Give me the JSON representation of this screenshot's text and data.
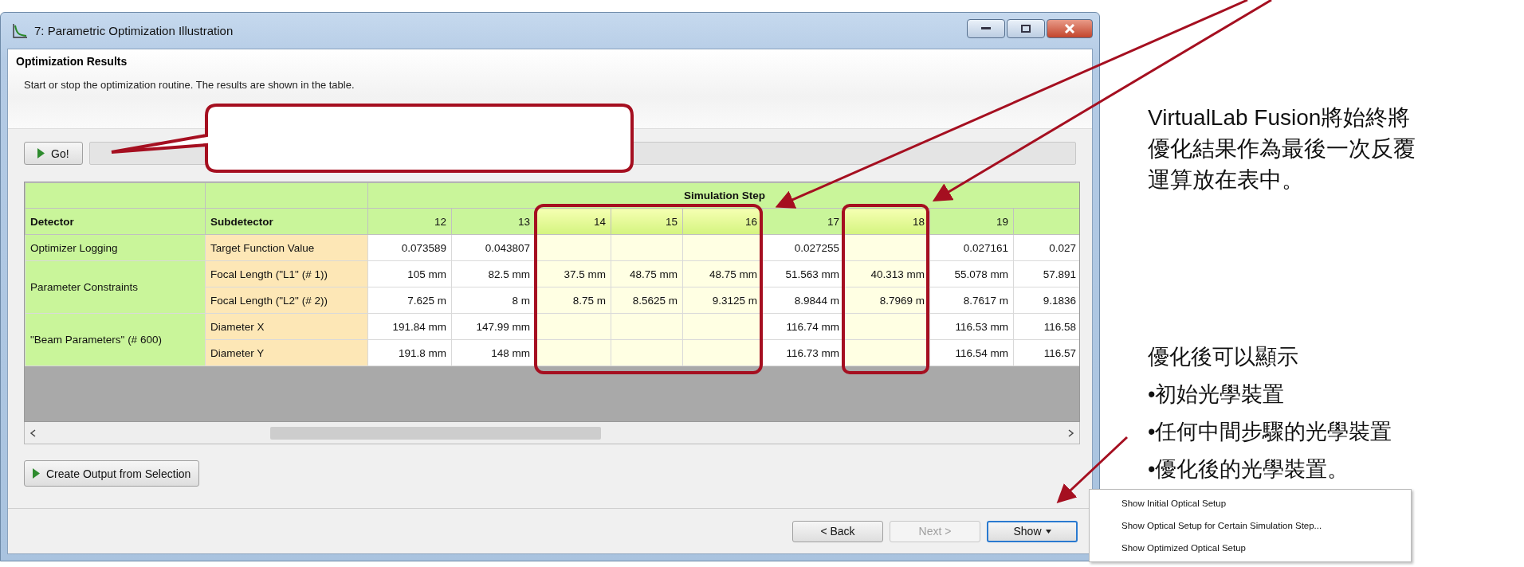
{
  "window": {
    "title": "7: Parametric Optimization Illustration"
  },
  "header": {
    "title": "Optimization Results",
    "description": "Start or stop the optimization routine. The results are shown in the table."
  },
  "go_button": {
    "label": "Go!"
  },
  "progress": {
    "level": 0
  },
  "table": {
    "group_header": "Simulation Step",
    "columns": [
      "Detector",
      "Subdetector"
    ],
    "steps": [
      {
        "label": "12",
        "selected": false
      },
      {
        "label": "13",
        "selected": false
      },
      {
        "label": "14",
        "selected": true
      },
      {
        "label": "15",
        "selected": true
      },
      {
        "label": "16",
        "selected": true
      },
      {
        "label": "17",
        "selected": false
      },
      {
        "label": "18",
        "selected": true
      },
      {
        "label": "19",
        "selected": false
      },
      {
        "selected": false
      }
    ],
    "groups": [
      {
        "detector": "Optimizer Logging",
        "rows": [
          {
            "subdetector": "Target Function Value",
            "cells": [
              {
                "kind": "value",
                "text": "0.073589"
              },
              {
                "kind": "value",
                "text": "0.043807"
              },
              {
                "kind": "blank"
              },
              {
                "kind": "blank"
              },
              {
                "kind": "blank"
              },
              {
                "kind": "value",
                "text": "0.027255"
              },
              {
                "kind": "blank"
              },
              {
                "kind": "value",
                "text": "0.027161"
              },
              {
                "kind": "value",
                "text": "0.027"
              }
            ]
          }
        ]
      },
      {
        "detector": "Parameter Constraints",
        "rows": [
          {
            "subdetector": "Focal Length (\"L1\" (# 1))",
            "cells": [
              {
                "kind": "value",
                "text": "105 mm"
              },
              {
                "kind": "value",
                "text": "82.5 mm"
              },
              {
                "kind": "value",
                "text": "37.5 mm"
              },
              {
                "kind": "value",
                "text": "48.75 mm"
              },
              {
                "kind": "value",
                "text": "48.75 mm"
              },
              {
                "kind": "value",
                "text": "51.563 mm"
              },
              {
                "kind": "value",
                "text": "40.313 mm"
              },
              {
                "kind": "value",
                "text": "55.078 mm"
              },
              {
                "kind": "value",
                "text": "57.891"
              }
            ]
          },
          {
            "subdetector": "Focal Length (\"L2\" (# 2))",
            "cells": [
              {
                "kind": "value",
                "text": "7.625 m"
              },
              {
                "kind": "value",
                "text": "8 m"
              },
              {
                "kind": "value",
                "text": "8.75 m"
              },
              {
                "kind": "value",
                "text": "8.5625 m"
              },
              {
                "kind": "value",
                "text": "9.3125 m"
              },
              {
                "kind": "value",
                "text": "8.9844 m"
              },
              {
                "kind": "value",
                "text": "8.7969 m"
              },
              {
                "kind": "value",
                "text": "8.7617 m"
              },
              {
                "kind": "value",
                "text": "9.1836"
              }
            ]
          }
        ]
      },
      {
        "detector": "\"Beam Parameters\" (# 600)",
        "rows": [
          {
            "subdetector": "Diameter X",
            "cells": [
              {
                "kind": "value",
                "text": "191.84 mm"
              },
              {
                "kind": "value",
                "text": "147.99 mm"
              },
              {
                "kind": "blank"
              },
              {
                "kind": "blank"
              },
              {
                "kind": "blank"
              },
              {
                "kind": "value",
                "text": "116.74 mm"
              },
              {
                "kind": "blank"
              },
              {
                "kind": "value",
                "text": "116.53 mm"
              },
              {
                "kind": "value",
                "text": "116.58"
              }
            ]
          },
          {
            "subdetector": "Diameter Y",
            "cells": [
              {
                "kind": "value",
                "text": "191.8 mm"
              },
              {
                "kind": "value",
                "text": "148 mm"
              },
              {
                "kind": "blank"
              },
              {
                "kind": "blank"
              },
              {
                "kind": "blank"
              },
              {
                "kind": "value",
                "text": "116.73 mm"
              },
              {
                "kind": "blank"
              },
              {
                "kind": "value",
                "text": "116.54 mm"
              },
              {
                "kind": "value",
                "text": "116.57"
              }
            ]
          }
        ]
      }
    ]
  },
  "create_output_button": {
    "label": "Create Output from Selection"
  },
  "buttons": [
    {
      "label": "< Back",
      "kind": "plain",
      "disabled": false,
      "focused": false
    },
    {
      "label": "Next >",
      "kind": "plain",
      "disabled": true,
      "focused": false
    },
    {
      "label": "Show",
      "kind": "dropdown",
      "disabled": false,
      "focused": true
    }
  ],
  "menu": {
    "items": [
      "Show Initial Optical Setup",
      "Show Optical Setup for Certain Simulation Step...",
      "Show Optimized Optical Setup"
    ]
  },
  "notes": [
    {
      "text": "VirtualLab Fusion將始終將優化結果作為最後一次反覆運算放在表中。"
    },
    {
      "heading": "優化後可以顯示",
      "bullets": [
        "•初始光學裝置",
        "•任何中間步驟的光學裝置",
        "•優化後的光學裝置。"
      ]
    }
  ]
}
